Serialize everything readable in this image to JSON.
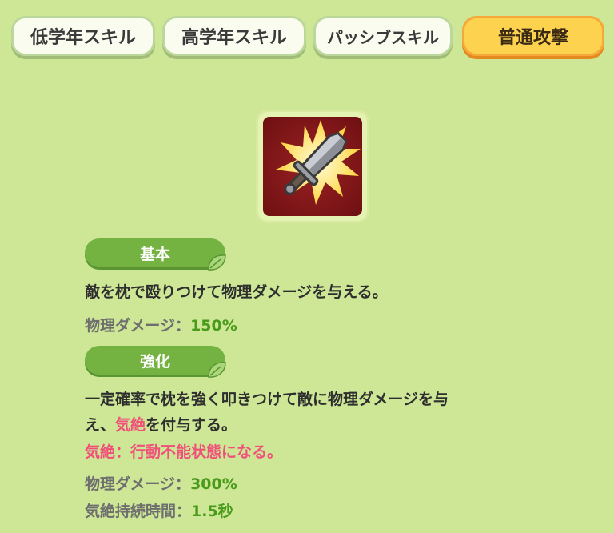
{
  "tabs": [
    {
      "label": "低学年スキル",
      "active": false
    },
    {
      "label": "高学年スキル",
      "active": false
    },
    {
      "label": "パッシブスキル",
      "active": false
    },
    {
      "label": "普通攻撃",
      "active": true
    }
  ],
  "skill_icon": "sword-icon",
  "basic": {
    "title": "基本",
    "description": "敵を枕で殴りつけて物理ダメージを与える。",
    "stat_label": "物理ダメージ：",
    "stat_value": "150%"
  },
  "enhanced": {
    "title": "強化",
    "description_line1": "一定確率で枕を強く叩きつけて敵に物理ダメージを与",
    "description_line2_prefix": "え、",
    "description_line2_keyword": "気絶",
    "description_line2_suffix": "を付与する。",
    "status_note": "気絶：行動不能状態になる。",
    "stats": [
      {
        "label": "物理ダメージ：",
        "value": "300%"
      },
      {
        "label": "気絶持続時間：",
        "value": "1.5秒"
      }
    ]
  },
  "colors": {
    "background": "#cde796",
    "active_tab": "#fcd24f",
    "pill": "#74b342",
    "value_green": "#4a9a1c",
    "status_pink": "#f0507a"
  }
}
